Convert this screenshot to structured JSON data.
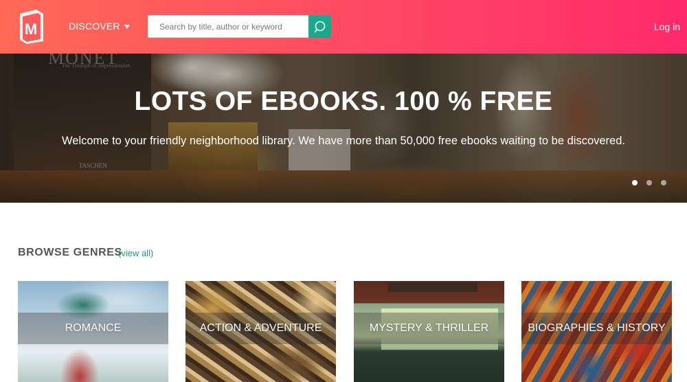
{
  "header": {
    "logo_letter": "M",
    "discover_label": "DISCOVER",
    "search_placeholder": "Search by title, author or keyword",
    "login_label": "Log in",
    "colors": {
      "gradient_start": "#ff6a55",
      "gradient_end": "#ff2a6c",
      "search_button": "#19a98e"
    }
  },
  "hero": {
    "title": "LOTS OF EBOOKS. 100 % FREE",
    "subtitle": "Welcome to your friendly neighborhood library. We have more than 50,000 free ebooks waiting to be discovered.",
    "background_book_text": {
      "title": "MONET",
      "subtitle": "The Triumph of Impressionism",
      "publisher": "TASCHEN"
    },
    "carousel": {
      "slide_count": 3,
      "active_index": 0
    }
  },
  "genres": {
    "heading": "BROWSE GENRES",
    "view_all_label": "(view all)",
    "items": [
      {
        "label": "ROMANCE"
      },
      {
        "label": "ACTION & ADVENTURE"
      },
      {
        "label": "MYSTERY & THRILLER"
      },
      {
        "label": "BIOGRAPHIES & HISTORY"
      }
    ]
  }
}
